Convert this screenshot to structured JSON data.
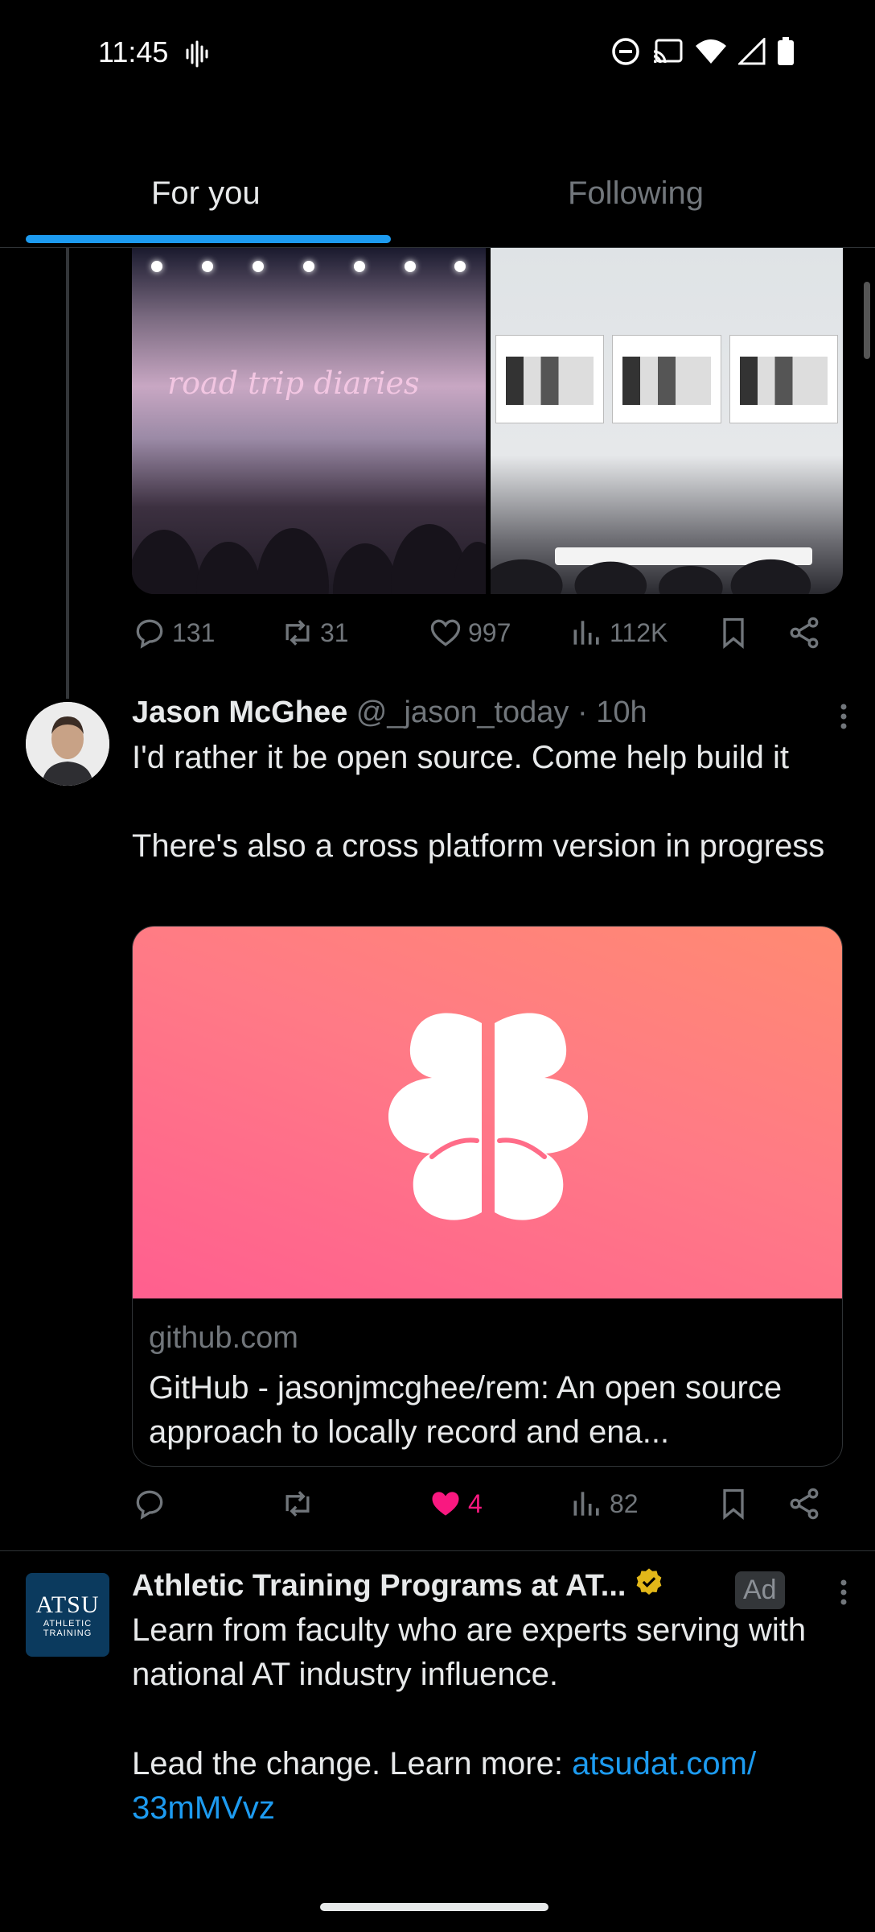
{
  "status_bar": {
    "time": "11:45",
    "icons": [
      "voicemail-wave-icon",
      "dnd-icon",
      "cast-icon",
      "wifi-icon",
      "signal-icon",
      "battery-icon"
    ]
  },
  "tabs": [
    {
      "label": "For you",
      "selected": true
    },
    {
      "label": "Following",
      "selected": false
    }
  ],
  "prev_tweet": {
    "media_text": "road trip diaries",
    "actions": {
      "replies": "131",
      "reposts": "31",
      "likes": "997",
      "views": "112K"
    }
  },
  "tweet": {
    "name": "Jason McGhee",
    "handle": "@_jason_today",
    "time": "· 10h",
    "text": "I'd rather it be open source. Come help build it\n\nThere's also a cross platform version in progress",
    "card": {
      "domain": "github.com",
      "title": "GitHub - jasonjmcghee/rem: An open source approach to locally record and ena..."
    },
    "actions": {
      "replies": "",
      "reposts": "",
      "likes": "4",
      "views": "82"
    },
    "liked": true
  },
  "ad": {
    "name": "Athletic Training Programs at AT...",
    "verified": true,
    "badge": "Ad",
    "logo_big": "ATSU",
    "logo_small": "ATHLETIC TRAINING",
    "text": "Learn from faculty who are experts serving with national AT industry influence.",
    "cta_prefix": "Lead the change. Learn more: ",
    "cta_link": "atsudat.com/ 33mMVvz"
  },
  "colors": {
    "accent": "#1d9bf0",
    "like": "#f91880",
    "muted": "#71767b",
    "text": "#e7e9ea",
    "background": "#000000"
  }
}
